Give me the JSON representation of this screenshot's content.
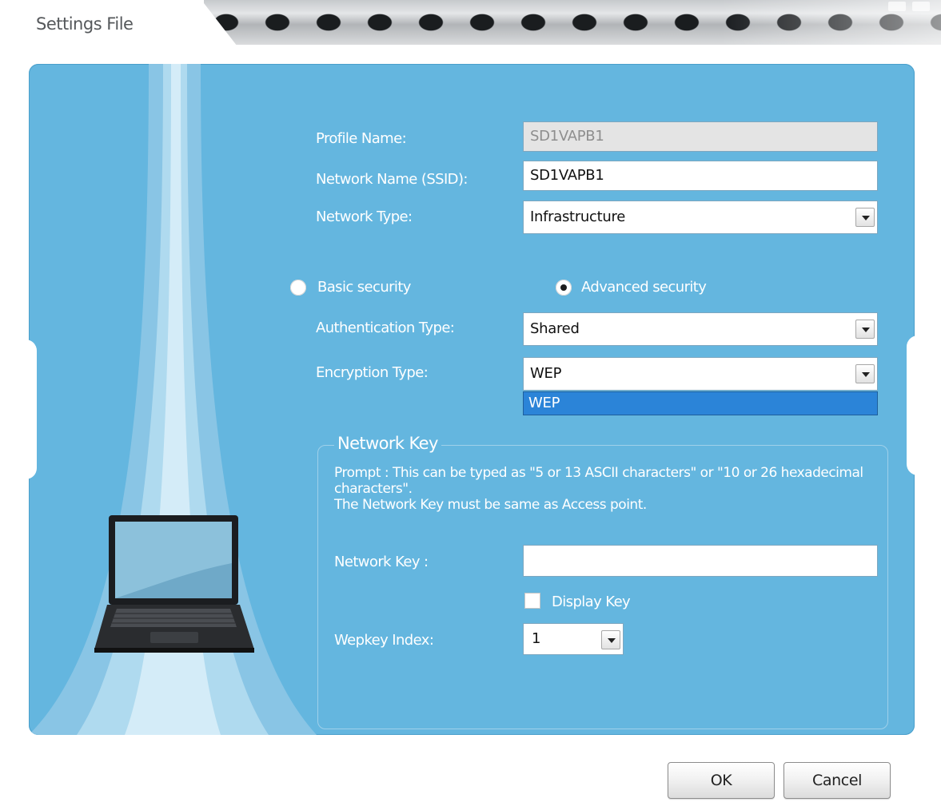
{
  "window": {
    "title": "Settings File"
  },
  "profile": {
    "profile_name_label": "Profile Name:",
    "profile_name_value": "SD1VAPB1",
    "ssid_label": "Network Name (SSID):",
    "ssid_value": "SD1VAPB1",
    "network_type_label": "Network Type:",
    "network_type_value": "Infrastructure"
  },
  "security": {
    "basic_label": "Basic security",
    "advanced_label": "Advanced security",
    "selected": "Advanced security",
    "auth_type_label": "Authentication Type:",
    "auth_type_value": "Shared",
    "encryption_type_label": "Encryption Type:",
    "encryption_type_value": "WEP",
    "encryption_dropdown_options": [
      "WEP"
    ]
  },
  "network_key": {
    "group_title": "Network Key",
    "prompt_line1": "Prompt : This can be typed as \"5 or 13 ASCII characters\" or \"10 or 26 hexadecimal characters\".",
    "prompt_line2": "The Network Key must be same as Access point.",
    "key_label": "Network Key :",
    "key_value": "",
    "display_key_label": "Display Key",
    "display_key_checked": false,
    "wepkey_index_label": "Wepkey Index:",
    "wepkey_index_value": "1"
  },
  "buttons": {
    "ok": "OK",
    "cancel": "Cancel"
  },
  "colors": {
    "panel": "#64b6df",
    "dropdown_highlight": "#2b84d8"
  },
  "icons": {
    "illustration": "laptop-icon"
  }
}
